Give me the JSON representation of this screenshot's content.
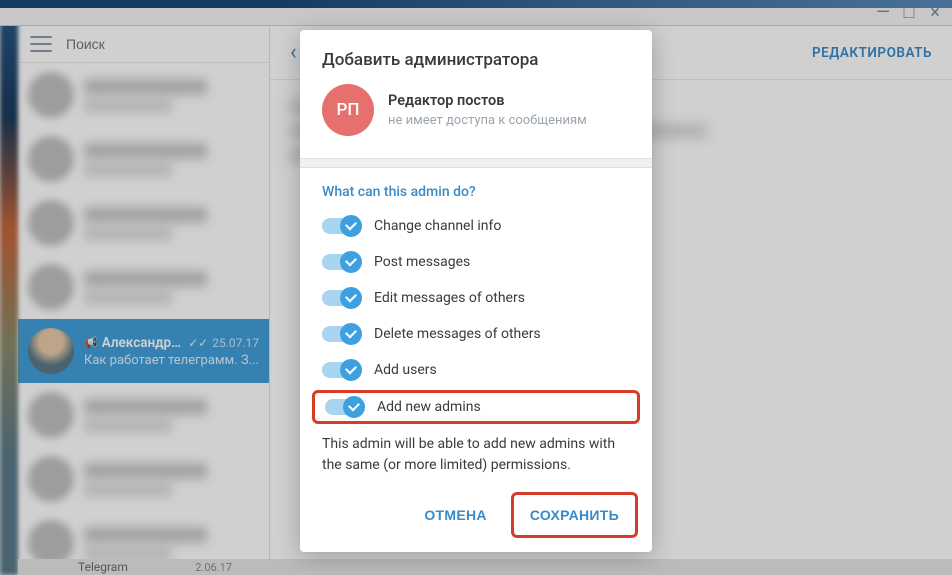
{
  "window": {
    "minimize": "—",
    "maximize": "□",
    "close": "×"
  },
  "sidebar": {
    "search_placeholder": "Поиск",
    "selected_chat": {
      "name": "Александр ...",
      "date": "25.07.17",
      "preview": "Как работает телеграмм. З..."
    }
  },
  "header": {
    "edit": "РЕДАКТИРОВАТЬ"
  },
  "dialog": {
    "title": "Добавить администратора",
    "admin": {
      "initials": "РП",
      "name": "Редактор постов",
      "status": "не имеет доступа к сообщениям"
    },
    "section_label": "What can this admin do?",
    "permissions": [
      {
        "label": "Change channel info"
      },
      {
        "label": "Post messages"
      },
      {
        "label": "Edit messages of others"
      },
      {
        "label": "Delete messages of others"
      },
      {
        "label": "Add users"
      },
      {
        "label": "Add new admins"
      }
    ],
    "note": "This admin will be able to add new admins with the same (or more limited) permissions.",
    "cancel": "ОТМЕНА",
    "save": "СОХРАНИТЬ"
  },
  "bottom": {
    "name": "Telegram",
    "date": "2.06.17"
  },
  "colors": {
    "accent": "#3ea0e0",
    "highlight": "#d83a2a",
    "avatar_bg": "#e6706e"
  }
}
